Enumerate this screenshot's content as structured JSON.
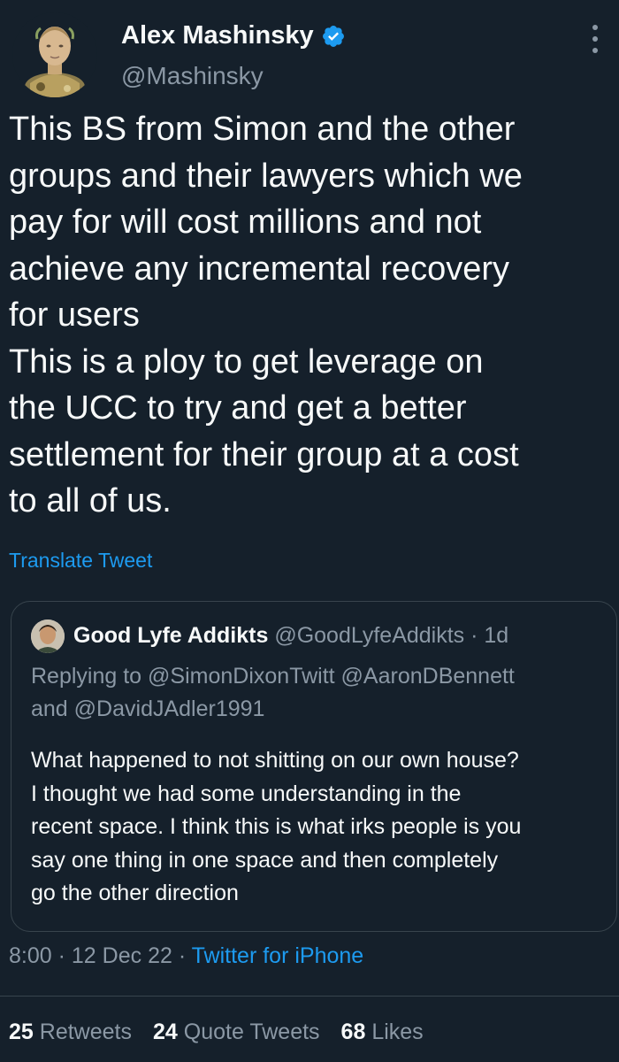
{
  "author": {
    "display_name": "Alex Mashinsky",
    "handle": "@Mashinsky",
    "verified": true,
    "avatar_icon": "astronaut-bust-avatar"
  },
  "tweet": {
    "lines": [
      "This BS from Simon and the other",
      "groups and their lawyers which we",
      "pay for will cost millions and not",
      "achieve any incremental recovery",
      "for users",
      "This is a ploy to get leverage on",
      "the UCC to try and get a better",
      "settlement for their group at a cost",
      "to all of us."
    ],
    "translate_label": "Translate Tweet"
  },
  "quote": {
    "display_name": "Good Lyfe Addikts",
    "handle": "@GoodLyfeAddikts",
    "separator": "·",
    "age": "1d",
    "replying_to_label": "Replying to",
    "mention_1": "@SimonDixonTwitt",
    "mention_2": "@AaronDBennett",
    "and_label": "and",
    "mention_3": "@DavidJAdler1991",
    "lines": [
      "What happened to not shitting on our own house?",
      "I thought we had some understanding in the",
      "recent space. I think this is what irks people is you",
      "say one thing in one space and then completely",
      "go the other direction"
    ]
  },
  "meta": {
    "time": "8:00",
    "date": "12 Dec 22",
    "separator": "·",
    "source": "Twitter for iPhone"
  },
  "stats": {
    "retweets_count": "25",
    "retweets_label": "Retweets",
    "quotes_count": "24",
    "quotes_label": "Quote Tweets",
    "likes_count": "68",
    "likes_label": "Likes"
  },
  "colors": {
    "background": "#15202b",
    "text": "#f7f9f9",
    "secondary": "#8b98a5",
    "accent": "#1d9bf0",
    "border": "#38444d"
  }
}
